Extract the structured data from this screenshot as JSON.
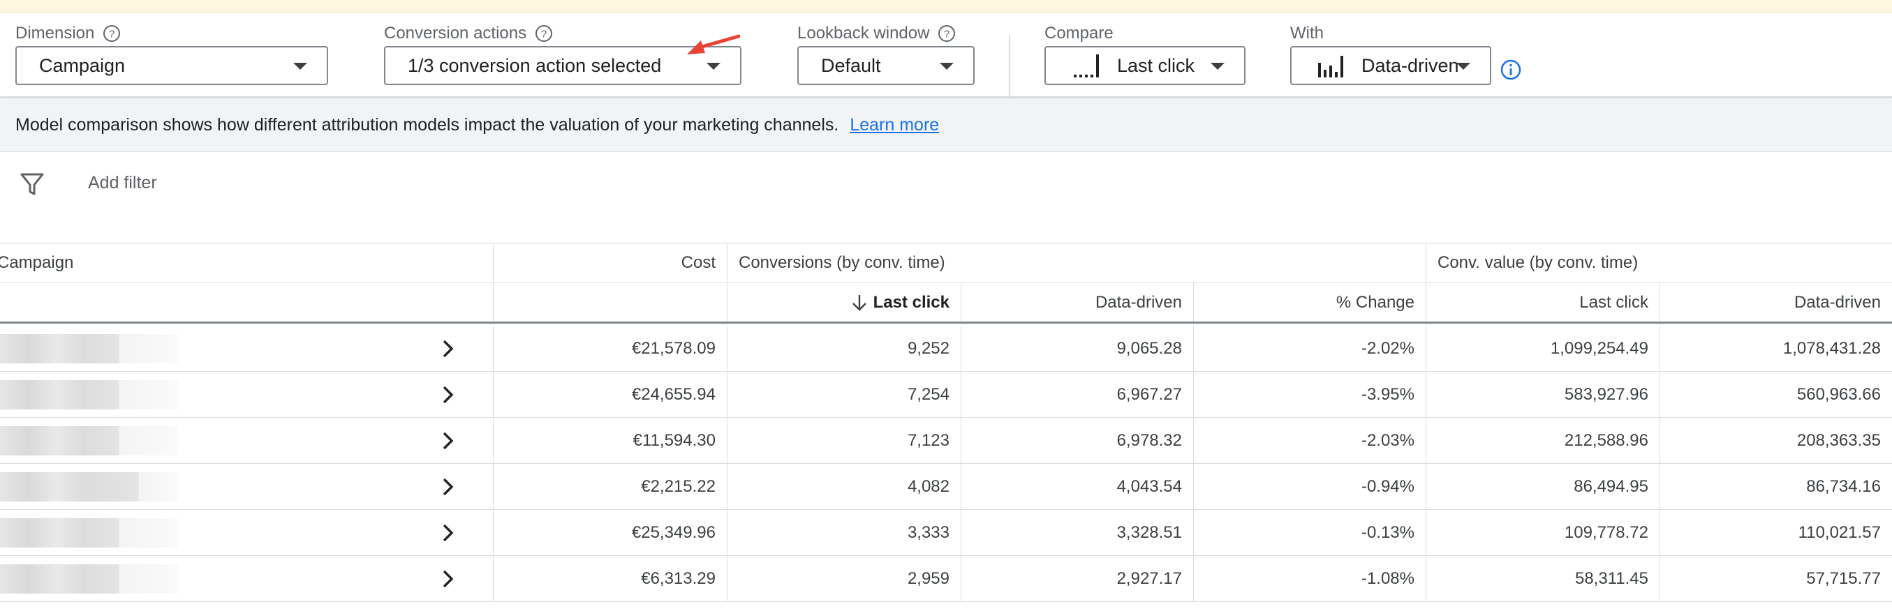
{
  "controls": {
    "dimension": {
      "label": "Dimension",
      "value": "Campaign"
    },
    "conversion_actions": {
      "label": "Conversion actions",
      "value": "1/3 conversion action selected"
    },
    "lookback": {
      "label": "Lookback window",
      "value": "Default"
    },
    "compare": {
      "label": "Compare",
      "value": "Last click",
      "icon": "last-click-model-icon"
    },
    "with": {
      "label": "With",
      "value": "Data-driven",
      "icon": "data-driven-model-icon"
    }
  },
  "banner": {
    "text": "Model comparison shows how different attribution models impact the valuation of your marketing channels.",
    "link": "Learn more"
  },
  "filter": {
    "placeholder": "Add filter"
  },
  "table": {
    "group_headers": {
      "campaign": "Campaign",
      "cost": "Cost",
      "conversions": "Conversions (by conv. time)",
      "conv_value": "Conv. value (by conv. time)"
    },
    "sub_headers": {
      "last_click": "Last click",
      "data_driven": "Data-driven",
      "pct_change": "% Change",
      "value_last_click": "Last click",
      "value_data_driven": "Data-driven"
    },
    "rows": [
      {
        "cost": "€21,578.09",
        "last_click": "9,252",
        "data_driven": "9,065.28",
        "pct_change": "-2.02%",
        "value_last_click": "1,099,254.49",
        "value_data_driven": "1,078,431.28"
      },
      {
        "cost": "€24,655.94",
        "last_click": "7,254",
        "data_driven": "6,967.27",
        "pct_change": "-3.95%",
        "value_last_click": "583,927.96",
        "value_data_driven": "560,963.66"
      },
      {
        "cost": "€11,594.30",
        "last_click": "7,123",
        "data_driven": "6,978.32",
        "pct_change": "-2.03%",
        "value_last_click": "212,588.96",
        "value_data_driven": "208,363.35"
      },
      {
        "cost": "€2,215.22",
        "last_click": "4,082",
        "data_driven": "4,043.54",
        "pct_change": "-0.94%",
        "value_last_click": "86,494.95",
        "value_data_driven": "86,734.16"
      },
      {
        "cost": "€25,349.96",
        "last_click": "3,333",
        "data_driven": "3,328.51",
        "pct_change": "-0.13%",
        "value_last_click": "109,778.72",
        "value_data_driven": "110,021.57"
      },
      {
        "cost": "€6,313.29",
        "last_click": "2,959",
        "data_driven": "2,927.17",
        "pct_change": "-1.08%",
        "value_last_click": "58,311.45",
        "value_data_driven": "57,715.77"
      }
    ]
  },
  "colors": {
    "link": "#1a73e8",
    "annotation_arrow": "#ea4335",
    "info": "#1a73e8"
  }
}
